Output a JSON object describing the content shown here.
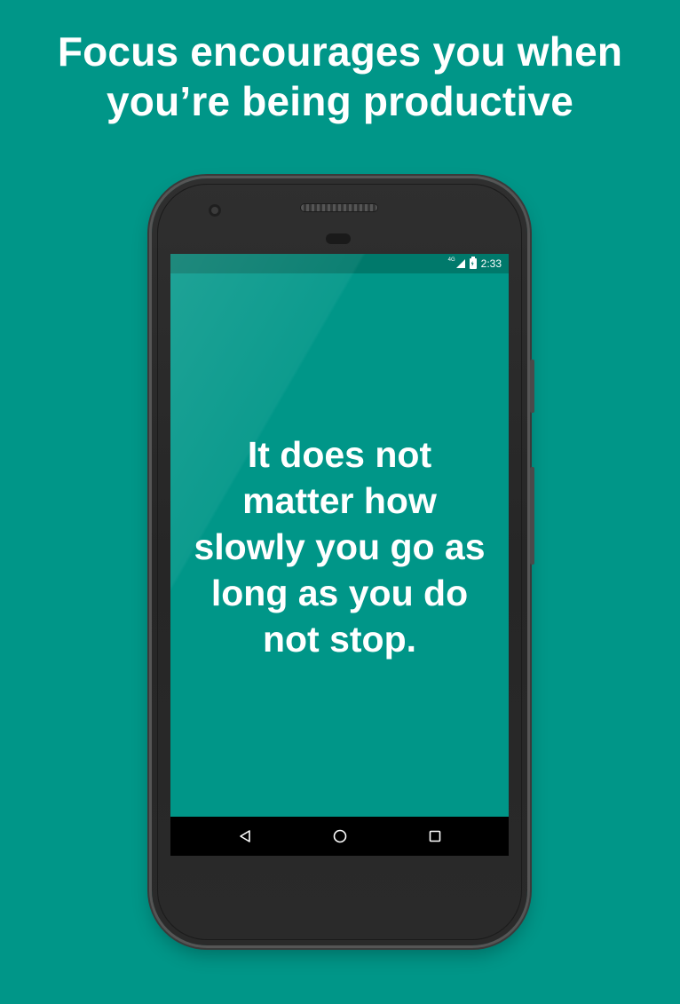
{
  "headline": {
    "line1": "Focus encourages you when",
    "line2": "you’re being productive"
  },
  "status_bar": {
    "network": "4G",
    "time": "2:33"
  },
  "quote": {
    "line1": "It does not",
    "line2": "matter how",
    "line3": "slowly you go as",
    "line4": "long as you do",
    "line5": "not stop."
  },
  "nav_bar": {
    "back_icon": "triangle-back-icon",
    "home_icon": "circle-home-icon",
    "recents_icon": "square-recents-icon"
  },
  "colors": {
    "background": "#009688",
    "status_bar": "#00796b",
    "nav_bar": "#000000",
    "text": "#ffffff"
  }
}
